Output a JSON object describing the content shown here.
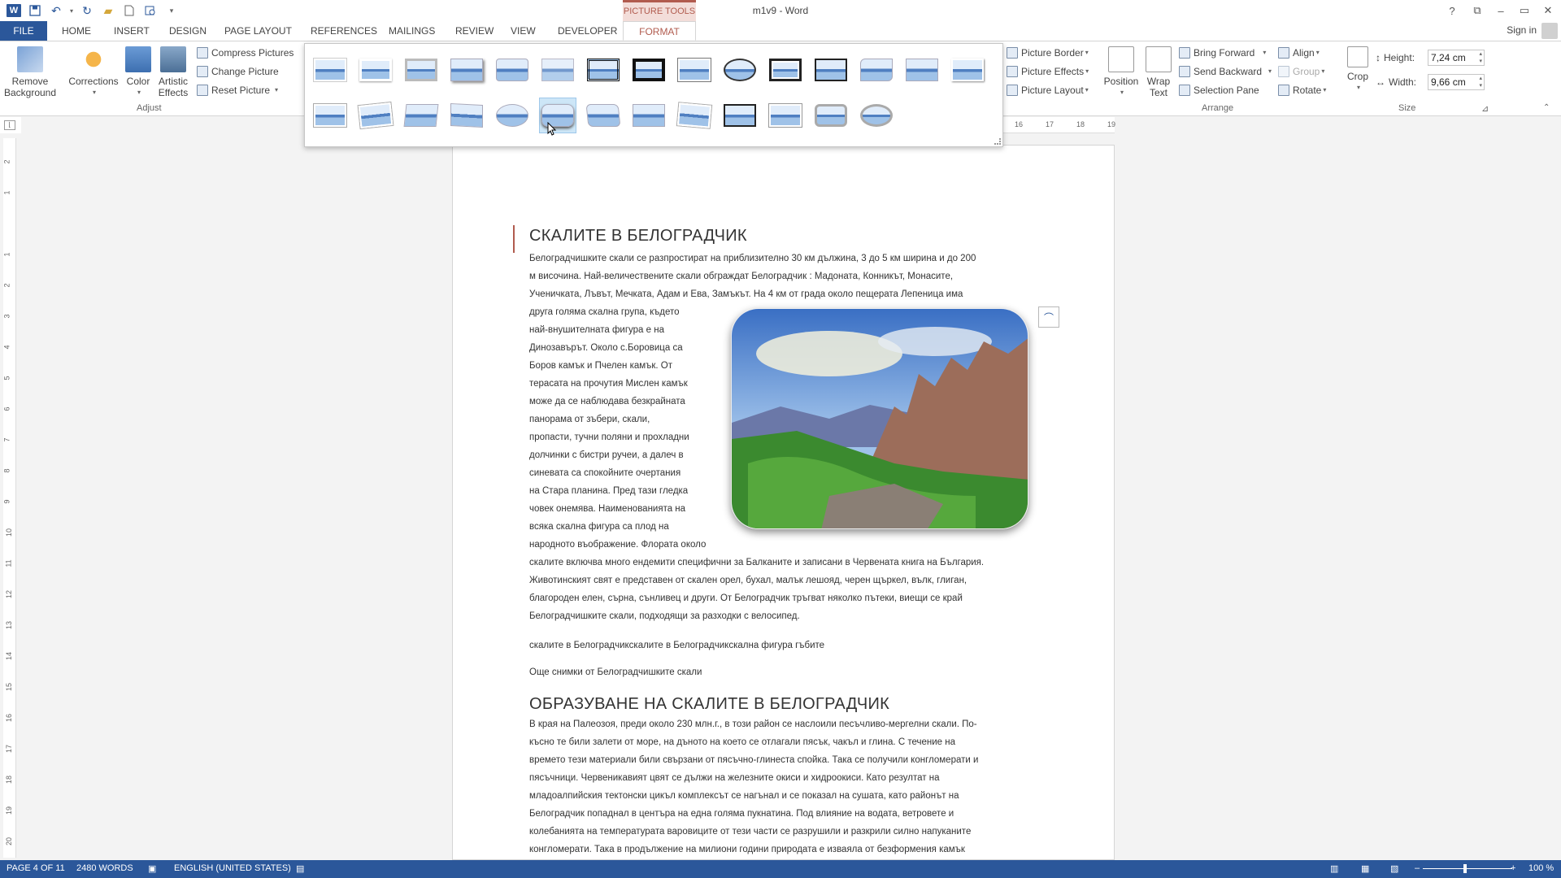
{
  "titlebar": {
    "doc_title": "m1v9 - Word",
    "context_tab": "PICTURE TOOLS",
    "help": "?",
    "restore": "⧉",
    "minimize": "–",
    "maximize": "▭",
    "close": "✕"
  },
  "tabs": [
    "FILE",
    "HOME",
    "INSERT",
    "DESIGN",
    "PAGE LAYOUT",
    "REFERENCES",
    "MAILINGS",
    "REVIEW",
    "VIEW",
    "DEVELOPER",
    "FORMAT"
  ],
  "signin": "Sign in",
  "ribbon": {
    "remove_background": "Remove Background",
    "corrections": "Corrections",
    "color": "Color",
    "artistic_effects": "Artistic Effects",
    "compress_pictures": "Compress Pictures",
    "change_picture": "Change Picture",
    "reset_picture": "Reset Picture",
    "adjust_label": "Adjust",
    "picture_border": "Picture Border",
    "picture_effects": "Picture Effects",
    "picture_layout": "Picture Layout",
    "position": "Position",
    "wrap_text": "Wrap Text",
    "bring_forward": "Bring Forward",
    "send_backward": "Send Backward",
    "selection_pane": "Selection Pane",
    "align": "Align",
    "group": "Group",
    "rotate": "Rotate",
    "arrange_label": "Arrange",
    "crop": "Crop",
    "height_label": "Height:",
    "height_value": "7,24 cm",
    "width_label": "Width:",
    "width_value": "9,66 cm",
    "size_label": "Size"
  },
  "ruler": {
    "h_ticks": [
      "16",
      "17",
      "18",
      "19"
    ],
    "v_ticks": [
      "2",
      "1",
      "1",
      "2",
      "3",
      "4",
      "5",
      "6",
      "7",
      "8",
      "9",
      "10",
      "11",
      "12",
      "13",
      "14",
      "15",
      "16",
      "17",
      "18",
      "19",
      "20"
    ]
  },
  "document": {
    "heading1": "СКАЛИТЕ В БЕЛОГРАДЧИК",
    "p1_lines": [
      "Белоградчишките скали се разпростират на приблизително 30 км дължина, 3 до 5 км ширина и до 200",
      "м височина. Най-величествените скали обграждат Белоградчик : Мадоната, Конникът, Монасите,",
      "Ученичката, Лъвът, Мечката, Адам и Ева, Замъкът. На 4 км от града около пещерата Лепеница има"
    ],
    "wrap_lines": [
      "друга голяма скална група, където",
      "най-внушителната фигура е на",
      "Динозавърът. Около с.Боровица са",
      "Боров камък и Пчелен камък. От",
      "терасата на прочутия Мислен камък",
      "може да се наблюдава безкрайната",
      "панорама от зъбери, скали,",
      "пропасти, тучни поляни и прохладни",
      "долчинки с бистри ручеи, а далеч в",
      "синевата са спокойните очертания",
      "на Стара планина. Пред тази гледка",
      "човек онемява. Наименованията на",
      "всяка скална фигура са плод на",
      "народното въображение. Флората около"
    ],
    "p2_lines": [
      "скалите включва много ендемити специфични за Балканите и записани в Червената книга на България.",
      "Животинският свят е представен от скален орел, бухал, малък лешояд, черен щъркел, вълк, глиган,",
      "благороден елен, сърна, сънливец и други. От Белоградчик тръгват няколко пътеки, виещи се край",
      "Белоградчишките скали, подходящи за разходки с велосипед."
    ],
    "p3": "скалите в Белоградчикскалите в Белоградчикскална фигура гъбите",
    "p4": "Още снимки от Белоградчишките скали",
    "heading2": "ОБРАЗУВАНЕ НА СКАЛИТЕ В БЕЛОГРАДЧИК",
    "p5_lines": [
      "В края на Палеозоя, преди около 230 млн.г., в този район се наслоили песъчливо-мергелни скали. По-",
      "късно те били залети от море, на дъното на което се отлагали пясък, чакъл и глина. С течение на",
      "времето тези материали били свързани от пясъчно-глинеста спойка. Така се получили конгломерати и",
      "пясъчници. Червеникавият цвят се дължи на железните окиси и хидроокиси. Като резултат на",
      "младоалпийския тектонски цикъл комплексът се нагънал и се показал на сушата, като районът на",
      "Белоградчик попаднал в центъра на една голяма пукнатина. Под влияние на водата, ветровете и",
      "колебанията на температурата варовиците от тези части се разрушили и разкрили силно напуканите",
      "конгломерати. Така в продължение на милиони години природата е изваяла от безформения камък"
    ]
  },
  "statusbar": {
    "page": "PAGE 4 OF 11",
    "words": "2480 WORDS",
    "language": "ENGLISH (UNITED STATES)",
    "zoom": "100 %",
    "zoom_minus": "–",
    "zoom_plus": "+"
  },
  "colors": {
    "word_blue": "#2b579a",
    "picture_tools_accent": "#b15b4e"
  }
}
